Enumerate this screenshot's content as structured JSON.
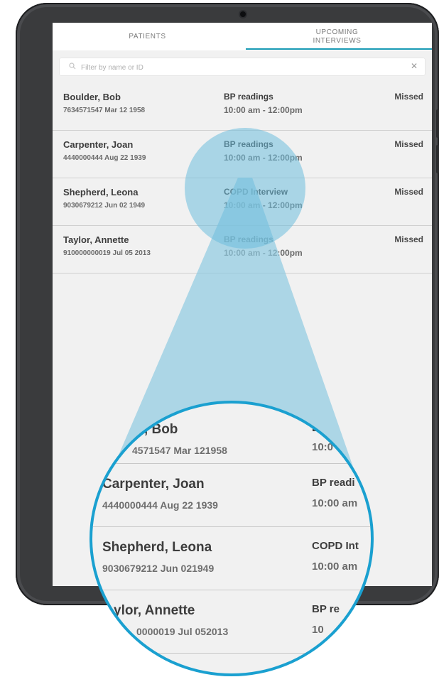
{
  "tabs": [
    {
      "label": "PATIENTS"
    },
    {
      "label": "UPCOMING\nINTERVIEWS"
    }
  ],
  "filter": {
    "placeholder": "Filter by name or ID",
    "clear_symbol": "✕"
  },
  "rows": [
    {
      "name": "Boulder, Bob",
      "id_dob": "7634571547 Mar 12 1958",
      "interview": "BP readings",
      "time": "10:00 am - 12:00pm",
      "status": "Missed"
    },
    {
      "name": "Carpenter, Joan",
      "id_dob": "4440000444 Aug 22 1939",
      "interview": "BP readings",
      "time": "10:00 am - 12:00pm",
      "status": "Missed"
    },
    {
      "name": "Shepherd, Leona",
      "id_dob": "9030679212 Jun 02 1949",
      "interview": "COPD Interview",
      "time": "10:00 am - 12:00pm",
      "status": "Missed"
    },
    {
      "name": "Taylor, Annette",
      "id_dob": "910000000019 Jul 05 2013",
      "interview": "BP readings",
      "time": "10:00 am - 12:00pm",
      "status": "Missed"
    }
  ],
  "magnified": [
    {
      "name": "er, Bob",
      "id_dob": "4571547 Mar 121958",
      "interview": "B",
      "time": "10:0"
    },
    {
      "name": "Carpenter, Joan",
      "id_dob": "4440000444 Aug 22 1939",
      "interview": "BP readi",
      "time": "10:00 am"
    },
    {
      "name": "Shepherd, Leona",
      "id_dob": "9030679212 Jun 021949",
      "interview": "COPD Int",
      "time": "10:00 am"
    },
    {
      "name": "ylor, Annette",
      "id_dob": "0000019 Jul 052013",
      "interview": "BP re",
      "time": "10"
    }
  ],
  "colors": {
    "accent": "#1a9bb5",
    "lens_ring": "#1aa0d0",
    "magnifier_beam": "#8fcbe1",
    "tablet_frame": "#3a3b3d"
  }
}
